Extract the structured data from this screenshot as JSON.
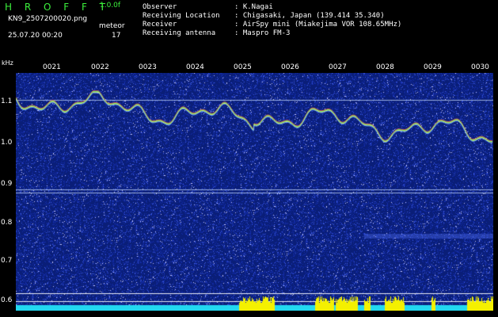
{
  "header": {
    "title": "H R O F F T",
    "version": "1.0.0f",
    "filename": "KN9_2507200020.png",
    "datetime": "25.07.20 00:20",
    "meteor_label": "meteor",
    "meteor_count": "17"
  },
  "info": [
    {
      "key": "Observer",
      "value": ": K.Nagai"
    },
    {
      "key": "Receiving Location",
      "value": ": Chigasaki, Japan (139.414 35.340)"
    },
    {
      "key": "Receiver",
      "value": ": AirSpy mini (Miakejima VOR 108.65MHz)"
    },
    {
      "key": "Receiving antenna",
      "value": ": Maspro FM-3"
    }
  ],
  "axis": {
    "unit": "kHz",
    "y_labels": [
      "1.1",
      "1.0",
      "0.9",
      "0.8",
      "0.7",
      "0.6"
    ],
    "time_labels": [
      "0021",
      "0022",
      "0023",
      "0024",
      "0025",
      "0026",
      "0027",
      "0028",
      "0029",
      "0030"
    ]
  },
  "colors": {
    "background": "#000000",
    "waterfall": "#0a1e78",
    "title": "#3cf03c",
    "count_bar": "#22d8f0",
    "meteor_spike": "#f4f000"
  }
}
